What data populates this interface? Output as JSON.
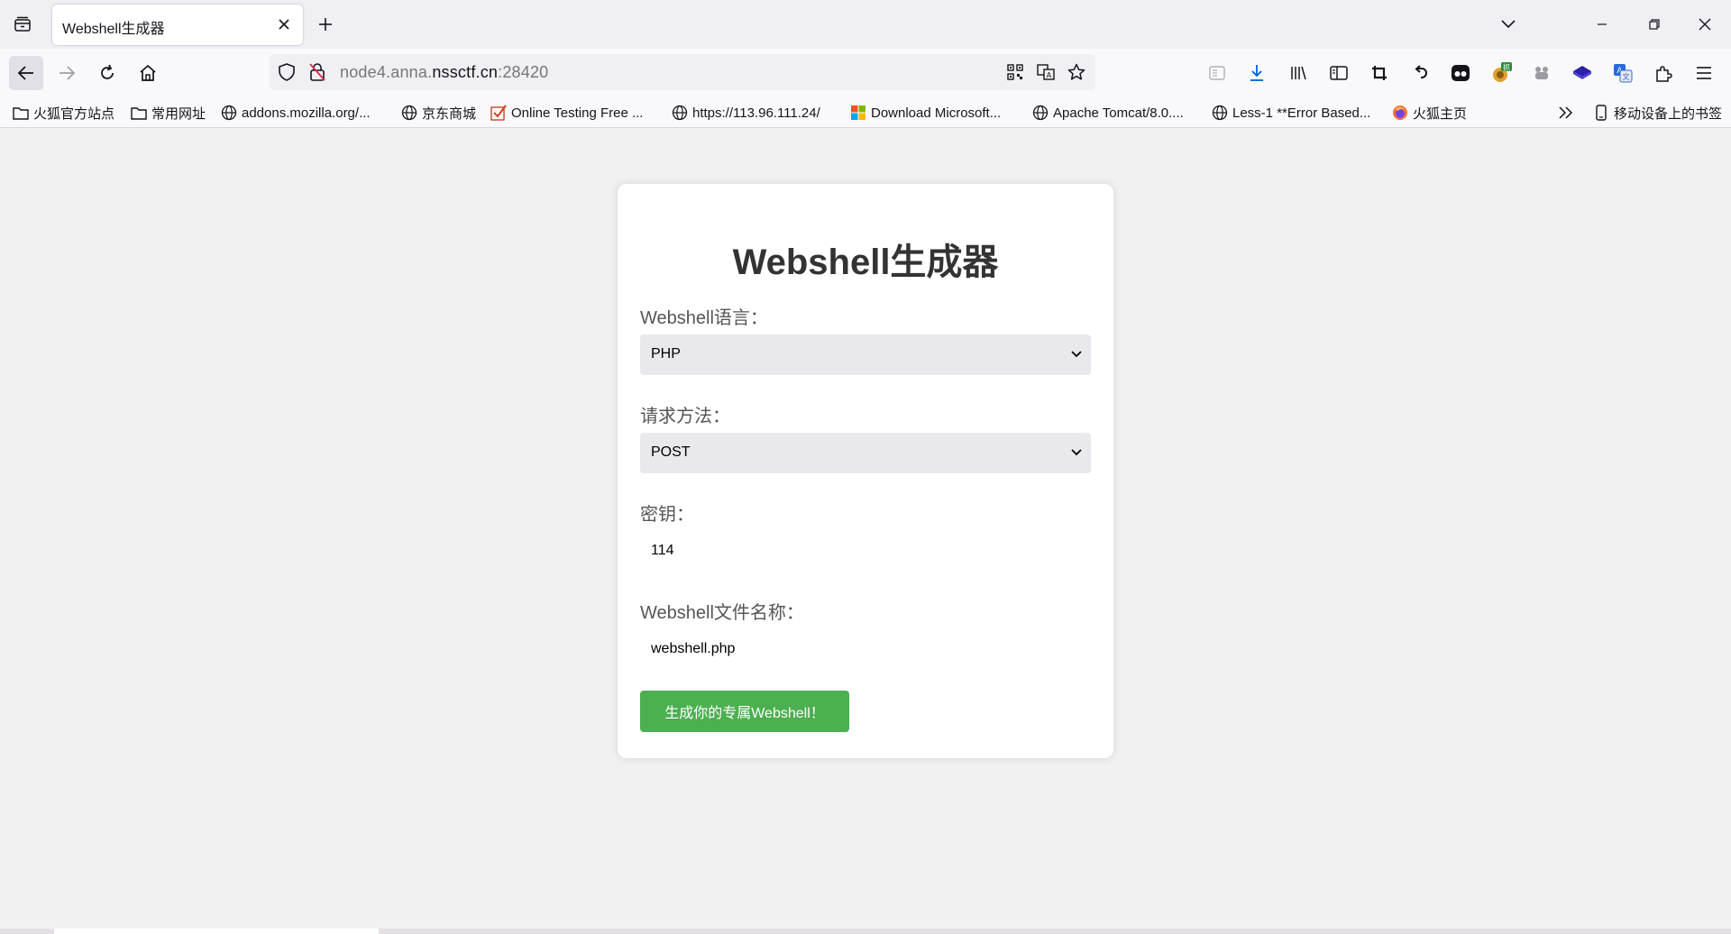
{
  "tab": {
    "title": "Webshell生成器",
    "close": "×",
    "new_tab": "+"
  },
  "address_bar": {
    "url_prefix": "node4.anna.",
    "url_domain": "nssctf.cn",
    "url_suffix": ":28420"
  },
  "bookmarks": [
    {
      "label": "火狐官方站点",
      "icon": "folder-icon"
    },
    {
      "label": "常用网址",
      "icon": "folder-icon"
    },
    {
      "label": "addons.mozilla.org/...",
      "icon": "globe-icon"
    },
    {
      "label": "京东商城",
      "icon": "globe-icon"
    },
    {
      "label": "Online Testing Free ...",
      "icon": "checkbox-icon"
    },
    {
      "label": "https://113.96.111.24/",
      "icon": "globe-icon"
    },
    {
      "label": "Download Microsoft...",
      "icon": "microsoft-icon"
    },
    {
      "label": "Apache Tomcat/8.0....",
      "icon": "globe-icon"
    },
    {
      "label": "Less-1 **Error Based...",
      "icon": "globe-icon"
    },
    {
      "label": "火狐主页",
      "icon": "firefox-icon"
    }
  ],
  "mobile_bookmarks": "移动设备上的书签",
  "page": {
    "title": "Webshell生成器",
    "language_label": "Webshell语言：",
    "language_value": "PHP",
    "method_label": "请求方法：",
    "method_value": "POST",
    "key_label": "密钥：",
    "key_value": "114",
    "filename_label": "Webshell文件名称：",
    "filename_value": "webshell.php",
    "submit_label": "生成你的专属Webshell！"
  },
  "colors": {
    "accent_green": "#4caf50",
    "page_bg": "#f1f1f1",
    "select_bg": "#e9e9ed"
  }
}
